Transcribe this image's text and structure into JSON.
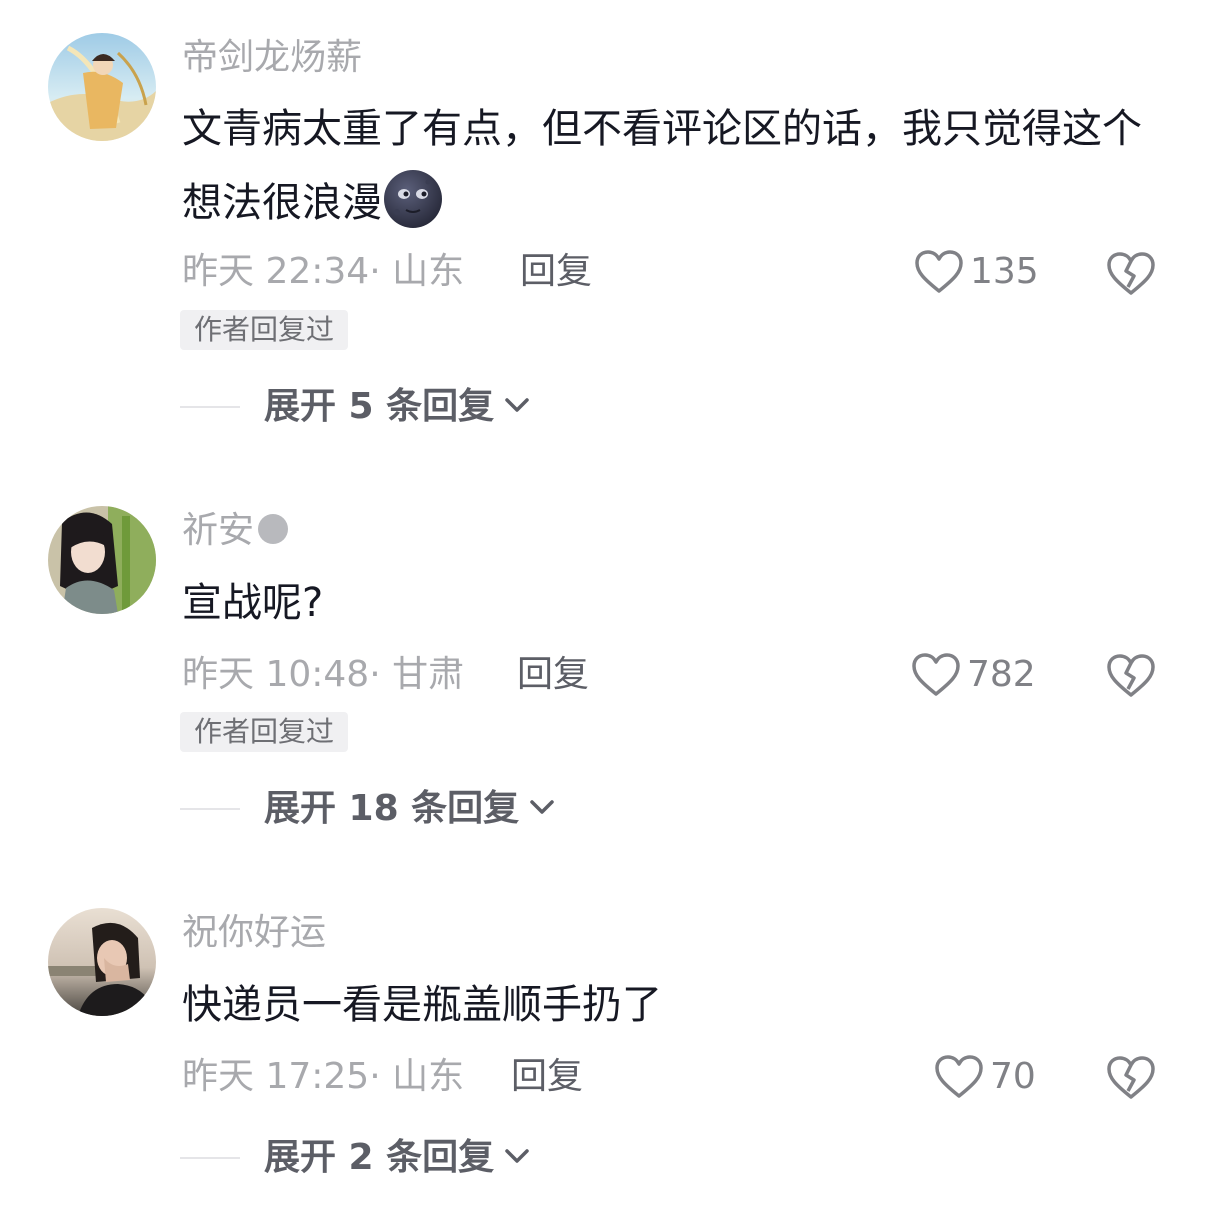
{
  "comments": [
    {
      "username": "帝剑龙炀薪",
      "text": "文青病太重了有点，但不看评论区的话，我只觉得这个想法很浪漫",
      "emoji": "new-moon-face-emoji",
      "time": "昨天 22:34",
      "location": "山东",
      "meta": "昨天 22:34· 山东",
      "reply_label": "回复",
      "likes": "135",
      "author_tag": "作者回复过",
      "expand_label": "展开 5 条回复"
    },
    {
      "username": "祈安",
      "online": true,
      "text": "宣战呢?",
      "time": "昨天 10:48",
      "location": "甘肃",
      "meta": "昨天 10:48· 甘肃",
      "reply_label": "回复",
      "likes": "782",
      "author_tag": "作者回复过",
      "expand_label": "展开 18 条回复"
    },
    {
      "username": "祝你好运",
      "text": "快递员一看是瓶盖顺手扔了",
      "time": "昨天 17:25",
      "location": "山东",
      "meta": "昨天 17:25· 山东",
      "reply_label": "回复",
      "likes": "70",
      "expand_label": "展开 2 条回复"
    }
  ],
  "icons": {
    "like": "heart-outline-icon",
    "dislike": "broken-heart-icon",
    "expand": "chevron-down-icon"
  },
  "colors": {
    "text": "#161823",
    "secondary": "#a8a9ad",
    "action": "#5c5e66",
    "tag_bg": "#f0f0f2"
  }
}
